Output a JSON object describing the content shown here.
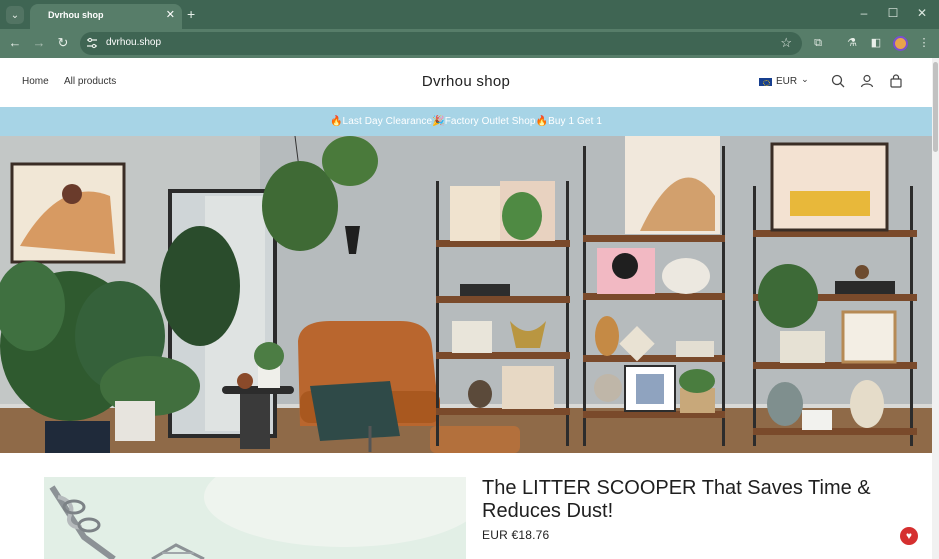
{
  "browser": {
    "tab_title": "Dvrhou shop",
    "tab_close": "✕",
    "new_tab": "+",
    "tab_list": "⌄",
    "url": "dvrhou.shop",
    "window_controls": {
      "minimize": "–",
      "maximize": "☐",
      "close": "✕"
    },
    "nav": {
      "back": "←",
      "forward": "→",
      "reload": "↻"
    },
    "icons": {
      "star": "☆",
      "extensions": "⧉",
      "labs": "⚗",
      "sidepanel": "◧",
      "menu": "⋮"
    }
  },
  "header": {
    "nav_home": "Home",
    "nav_all_products": "All products",
    "title": "Dvrhou shop",
    "currency": "EUR",
    "currency_caret": "⌄"
  },
  "announcement": {
    "text": "🔥Last Day Clearance🎉Factory Outlet Shop🔥Buy 1 Get 1"
  },
  "product": {
    "title": "The LITTER SCOOPER That Saves Time & Reduces Dust!",
    "price": "EUR €18.76"
  },
  "chat": {
    "icon": "♥"
  },
  "colors": {
    "chrome_dark": "#3f6553",
    "chrome_light": "#577d69",
    "announcement_bg": "#a7d4e6",
    "chat_red": "#d52f2f"
  }
}
